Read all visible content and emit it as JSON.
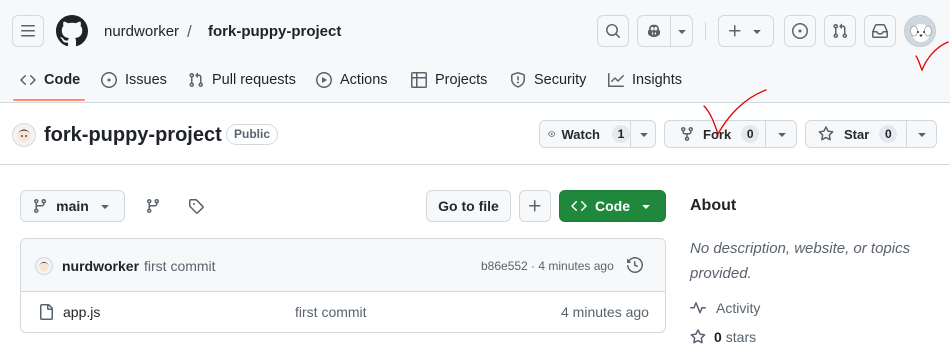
{
  "header": {
    "owner": "nurdworker",
    "separator": "/",
    "repo": "fork-puppy-project",
    "avatar_color": "#d0d7de"
  },
  "tabs": [
    {
      "label": "Code",
      "icon": "code-icon",
      "selected": true
    },
    {
      "label": "Issues",
      "icon": "issue-opened-icon"
    },
    {
      "label": "Pull requests",
      "icon": "git-pull-request-icon"
    },
    {
      "label": "Actions",
      "icon": "play-icon"
    },
    {
      "label": "Projects",
      "icon": "table-icon"
    },
    {
      "label": "Security",
      "icon": "shield-icon"
    },
    {
      "label": "Insights",
      "icon": "graph-icon"
    }
  ],
  "repo_bar": {
    "name": "fork-puppy-project",
    "visibility": "Public",
    "watch_label": "Watch",
    "watch_count": "1",
    "fork_label": "Fork",
    "fork_count": "0",
    "star_label": "Star",
    "star_count": "0"
  },
  "toolbar": {
    "branch": "main",
    "go_to_file": "Go to file",
    "add": "+",
    "code_label": "Code",
    "code_color": "#1f883d"
  },
  "commit": {
    "author": "nurdworker",
    "message": "first commit",
    "sha_time": "b86e552 · 4 minutes ago"
  },
  "files": [
    {
      "name": "app.js",
      "message": "first commit",
      "time": "4 minutes ago"
    }
  ],
  "about": {
    "heading": "About",
    "description": "No description, website, or topics provided.",
    "activity": "Activity",
    "stars_count": "0",
    "stars_label": "stars"
  },
  "annotation_color": "#e00000"
}
